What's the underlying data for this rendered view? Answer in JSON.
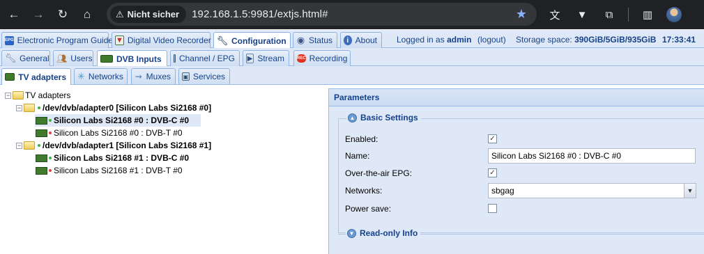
{
  "browser": {
    "security_label": "Nicht sicher",
    "url": "192.168.1.5:9981/extjs.html#"
  },
  "main_tabs": [
    {
      "label": "Electronic Program Guide",
      "icon": "epg-icon"
    },
    {
      "label": "Digital Video Recorder",
      "icon": "dvr-icon"
    },
    {
      "label": "Configuration",
      "icon": "wrench-icon",
      "active": true
    },
    {
      "label": "Status",
      "icon": "eye-icon"
    },
    {
      "label": "About",
      "icon": "info-icon"
    }
  ],
  "status": {
    "logged_in_prefix": "Logged in as",
    "user": "admin",
    "logout": "(logout)",
    "storage_label": "Storage space:",
    "storage_value": "390GiB/5GiB/935GiB",
    "time": "17:33:41"
  },
  "config_tabs": [
    {
      "label": "General",
      "icon": "wrench-icon"
    },
    {
      "label": "Users",
      "icon": "users-icon"
    },
    {
      "label": "DVB Inputs",
      "icon": "adapter-icon",
      "active": true
    },
    {
      "label": "Channel / EPG",
      "icon": "tv-icon"
    },
    {
      "label": "Stream",
      "icon": "stream-icon"
    },
    {
      "label": "Recording",
      "icon": "rec-icon"
    }
  ],
  "dvb_tabs": [
    {
      "label": "TV adapters",
      "icon": "adapter-icon",
      "active": true
    },
    {
      "label": "Networks",
      "icon": "network-icon"
    },
    {
      "label": "Muxes",
      "icon": "mux-icon"
    },
    {
      "label": "Services",
      "icon": "services-icon"
    }
  ],
  "tree": {
    "root": "TV adapters",
    "adapters": [
      {
        "label": "/dev/dvb/adapter0 [Silicon Labs Si2168 #0]",
        "status": "green",
        "frontends": [
          {
            "label": "Silicon Labs Si2168 #0 : DVB-C #0",
            "status": "green",
            "selected": true
          },
          {
            "label": "Silicon Labs Si2168 #0 : DVB-T #0",
            "status": "red"
          }
        ]
      },
      {
        "label": "/dev/dvb/adapter1 [Silicon Labs Si2168 #1]",
        "status": "green",
        "frontends": [
          {
            "label": "Silicon Labs Si2168 #1 : DVB-C #0",
            "status": "green"
          },
          {
            "label": "Silicon Labs Si2168 #1 : DVB-T #0",
            "status": "red"
          }
        ]
      }
    ]
  },
  "parameters": {
    "title": "Parameters",
    "basic_settings": {
      "legend": "Basic Settings",
      "enabled_label": "Enabled:",
      "enabled": true,
      "name_label": "Name:",
      "name_value": "Silicon Labs Si2168 #0 : DVB-C #0",
      "ota_epg_label": "Over-the-air EPG:",
      "ota_epg": true,
      "networks_label": "Networks:",
      "networks_value": "sbgag",
      "power_save_label": "Power save:",
      "power_save": false
    },
    "readonly_info": {
      "legend": "Read-only Info"
    }
  }
}
